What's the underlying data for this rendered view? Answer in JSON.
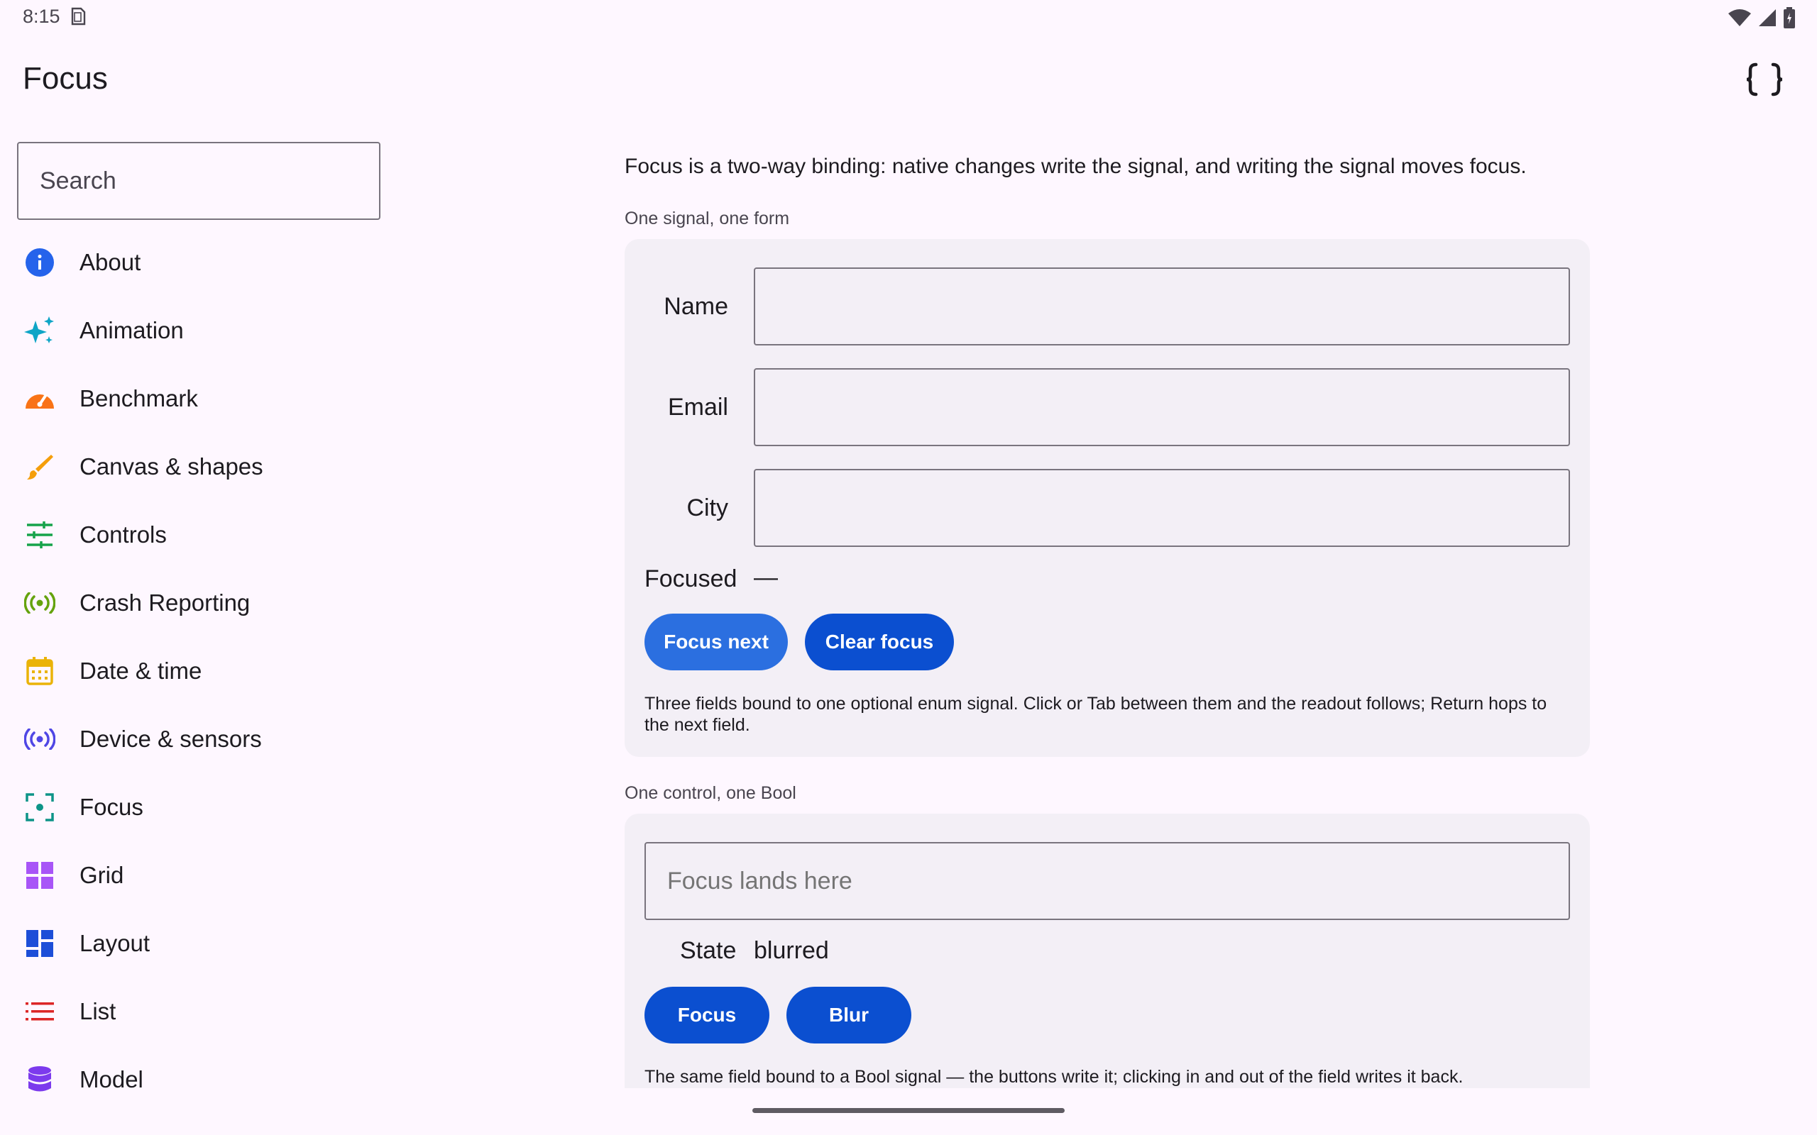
{
  "status": {
    "time": "8:15"
  },
  "app": {
    "title": "Focus"
  },
  "search": {
    "placeholder": "Search"
  },
  "nav": {
    "items": [
      {
        "label": "About",
        "icon": "info-icon",
        "color": "#2563eb"
      },
      {
        "label": "Animation",
        "icon": "sparkle-icon",
        "color": "#0ea5c6"
      },
      {
        "label": "Benchmark",
        "icon": "speedometer-icon",
        "color": "#f97316"
      },
      {
        "label": "Canvas & shapes",
        "icon": "brush-icon",
        "color": "#f59e0b"
      },
      {
        "label": "Controls",
        "icon": "sliders-icon",
        "color": "#16a34a"
      },
      {
        "label": "Crash Reporting",
        "icon": "broadcast-icon",
        "color": "#65a30d"
      },
      {
        "label": "Date & time",
        "icon": "calendar-icon",
        "color": "#eab308"
      },
      {
        "label": "Device & sensors",
        "icon": "sensor-icon",
        "color": "#4f46e5"
      },
      {
        "label": "Focus",
        "icon": "focus-icon",
        "color": "#0d9488"
      },
      {
        "label": "Grid",
        "icon": "grid-icon",
        "color": "#a855f7"
      },
      {
        "label": "Layout",
        "icon": "layout-icon",
        "color": "#1d4ed8"
      },
      {
        "label": "List",
        "icon": "list-icon",
        "color": "#dc2626"
      },
      {
        "label": "Model",
        "icon": "database-icon",
        "color": "#7c3aed"
      }
    ]
  },
  "main": {
    "intro": "Focus is a two-way binding: native changes write the signal, and writing the signal moves focus.",
    "section1": {
      "label": "One signal, one form",
      "fields": [
        {
          "label": "Name",
          "value": ""
        },
        {
          "label": "Email",
          "value": ""
        },
        {
          "label": "City",
          "value": ""
        }
      ],
      "focused_label": "Focused",
      "focused_value": "—",
      "focus_next": "Focus next",
      "clear_focus": "Clear focus",
      "help": "Three fields bound to one optional enum signal. Click or Tab between them and the readout follows; Return hops to the next field."
    },
    "section2": {
      "label": "One control, one Bool",
      "field_placeholder": "Focus lands here",
      "state_label": "State",
      "state_value": "blurred",
      "focus_button": "Focus",
      "blur_button": "Blur",
      "help": "The same field bound to a Bool signal — the buttons write it; clicking in and out of the field writes it back."
    }
  },
  "colors": {
    "background": "#fef7ff",
    "card": "#f3eff6",
    "primary_light": "#2b6fe0",
    "primary_dark": "#0b4fd0"
  }
}
